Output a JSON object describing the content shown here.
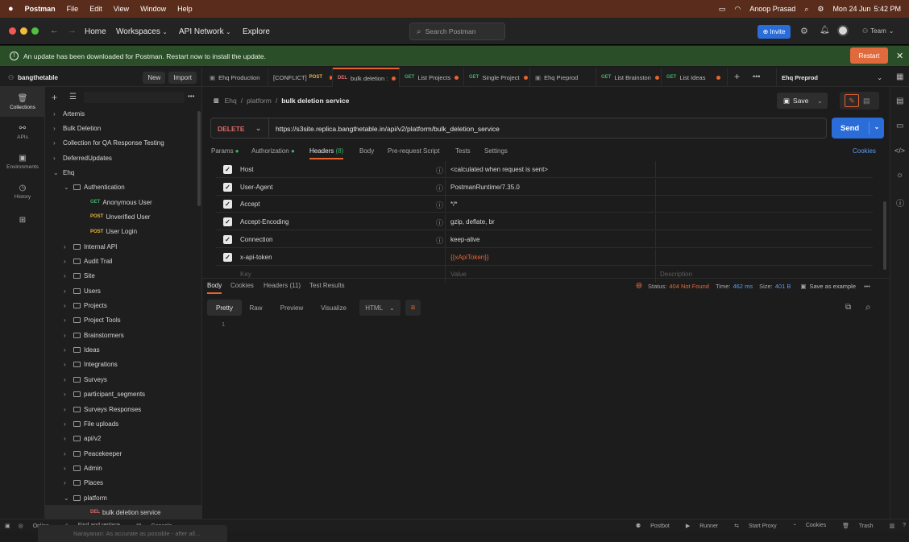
{
  "menubar": {
    "app": "Postman",
    "items": [
      "File",
      "Edit",
      "View",
      "Window",
      "Help"
    ],
    "user": "Anoop Prasad",
    "date": "Mon 24 Jun",
    "time": "5:42 PM"
  },
  "titlebar": {
    "home": "Home",
    "workspaces": "Workspaces",
    "network": "API Network",
    "explore": "Explore",
    "search_placeholder": "Search Postman",
    "invite": "Invite",
    "team": "Team"
  },
  "update": {
    "message": "An update has been downloaded for Postman. Restart now to install the update.",
    "restart": "Restart"
  },
  "workspace": {
    "name": "bangthetable",
    "new": "New",
    "import": "Import"
  },
  "tabs": [
    {
      "method": "",
      "label": "Ehq Production",
      "dot": false
    },
    {
      "method": "POST",
      "label": "[CONFLICT]",
      "dot": true
    },
    {
      "method": "DEL",
      "label": "bulk deletion :",
      "dot": true
    },
    {
      "method": "GET",
      "label": "List Projects",
      "dot": true
    },
    {
      "method": "GET",
      "label": "Single Project",
      "dot": true
    },
    {
      "method": "",
      "label": "Ehq Preprod",
      "dot": false
    },
    {
      "method": "GET",
      "label": "List Brainston",
      "dot": true
    },
    {
      "method": "GET",
      "label": "List Ideas",
      "dot": true
    }
  ],
  "environment": "Ehq Preprod",
  "leftnav": [
    "Collections",
    "APIs",
    "Environments",
    "History"
  ],
  "tree": [
    {
      "label": "Artemis",
      "level": 0,
      "type": "collection",
      "open": false
    },
    {
      "label": "Bulk Deletion",
      "level": 0,
      "type": "collection",
      "open": false
    },
    {
      "label": "Collection for QA Response Testing",
      "level": 0,
      "type": "collection",
      "open": false
    },
    {
      "label": "DeferredUpdates",
      "level": 0,
      "type": "collection",
      "open": false
    },
    {
      "label": "Ehq",
      "level": 0,
      "type": "collection",
      "open": true
    },
    {
      "label": "Authentication",
      "level": 1,
      "type": "folder",
      "open": true
    },
    {
      "label": "Anonymous User",
      "level": 2,
      "type": "request",
      "method": "GET"
    },
    {
      "label": "Unverified User",
      "level": 2,
      "type": "request",
      "method": "POST"
    },
    {
      "label": "User Login",
      "level": 2,
      "type": "request",
      "method": "POST"
    },
    {
      "label": "Internal API",
      "level": 1,
      "type": "folder",
      "open": false
    },
    {
      "label": "Audit Trail",
      "level": 1,
      "type": "folder",
      "open": false
    },
    {
      "label": "Site",
      "level": 1,
      "type": "folder",
      "open": false
    },
    {
      "label": "Users",
      "level": 1,
      "type": "folder",
      "open": false
    },
    {
      "label": "Projects",
      "level": 1,
      "type": "folder",
      "open": false
    },
    {
      "label": "Project Tools",
      "level": 1,
      "type": "folder",
      "open": false
    },
    {
      "label": "Brainstormers",
      "level": 1,
      "type": "folder",
      "open": false
    },
    {
      "label": "Ideas",
      "level": 1,
      "type": "folder",
      "open": false
    },
    {
      "label": "Integrations",
      "level": 1,
      "type": "folder",
      "open": false
    },
    {
      "label": "Surveys",
      "level": 1,
      "type": "folder",
      "open": false
    },
    {
      "label": "participant_segments",
      "level": 1,
      "type": "folder",
      "open": false
    },
    {
      "label": "Surveys Responses",
      "level": 1,
      "type": "folder",
      "open": false
    },
    {
      "label": "File uploads",
      "level": 1,
      "type": "folder",
      "open": false
    },
    {
      "label": "api/v2",
      "level": 1,
      "type": "folder",
      "open": false
    },
    {
      "label": "Peacekeeper",
      "level": 1,
      "type": "folder",
      "open": false
    },
    {
      "label": "Admin",
      "level": 1,
      "type": "folder",
      "open": false
    },
    {
      "label": "Places",
      "level": 1,
      "type": "folder",
      "open": false
    },
    {
      "label": "platform",
      "level": 1,
      "type": "folder",
      "open": true
    },
    {
      "label": "bulk deletion service",
      "level": 2,
      "type": "request",
      "method": "DEL",
      "selected": true
    }
  ],
  "breadcrumb": {
    "root": "Ehq",
    "folder": "platform",
    "current": "bulk deletion service"
  },
  "save": "Save",
  "request": {
    "method": "DELETE",
    "url": "https://s3site.replica.bangthetable.in/api/v2/platform/bulk_deletion_service",
    "send": "Send"
  },
  "request_tabs": {
    "params": "Params",
    "authorization": "Authorization",
    "headers": "Headers",
    "headers_count": "(8)",
    "body": "Body",
    "prerequest": "Pre-request Script",
    "tests": "Tests",
    "settings": "Settings",
    "cookies": "Cookies"
  },
  "headers": [
    {
      "key": "Host",
      "value": "<calculated when request is sent>",
      "info": true
    },
    {
      "key": "User-Agent",
      "value": "PostmanRuntime/7.35.0",
      "info": true
    },
    {
      "key": "Accept",
      "value": "*/*",
      "info": true
    },
    {
      "key": "Accept-Encoding",
      "value": "gzip, deflate, br",
      "info": true
    },
    {
      "key": "Connection",
      "value": "keep-alive",
      "info": true
    },
    {
      "key": "x-api-token",
      "value": "{{xApiToken}}",
      "info": false
    }
  ],
  "header_placeholders": {
    "key": "Key",
    "value": "Value",
    "description": "Description"
  },
  "response_tabs": {
    "body": "Body",
    "cookies": "Cookies",
    "headers": "Headers (11)",
    "results": "Test Results"
  },
  "status": {
    "label": "Status:",
    "code": "404 Not Found",
    "time_label": "Time:",
    "time": "462 ms",
    "size_label": "Size:",
    "size": "401 B",
    "save_example": "Save as example"
  },
  "format": {
    "pretty": "Pretty",
    "raw": "Raw",
    "preview": "Preview",
    "visualize": "Visualize",
    "type": "HTML"
  },
  "editor": {
    "line": "1"
  },
  "bottombar": {
    "online": "Online",
    "find": "Find and replace",
    "console": "Console",
    "postbot": "Postbot",
    "runner": "Runner",
    "proxy": "Start Proxy",
    "cookies": "Cookies",
    "trash": "Trash"
  },
  "notification": "Narayanan: As accurate as possible - after all...",
  "colors": {
    "accent": "#e8632f",
    "send": "#2a6cd8",
    "get": "#3fae6b",
    "post": "#e6b43c",
    "del": "#e06a6a",
    "status_error": "#e06a3c"
  }
}
